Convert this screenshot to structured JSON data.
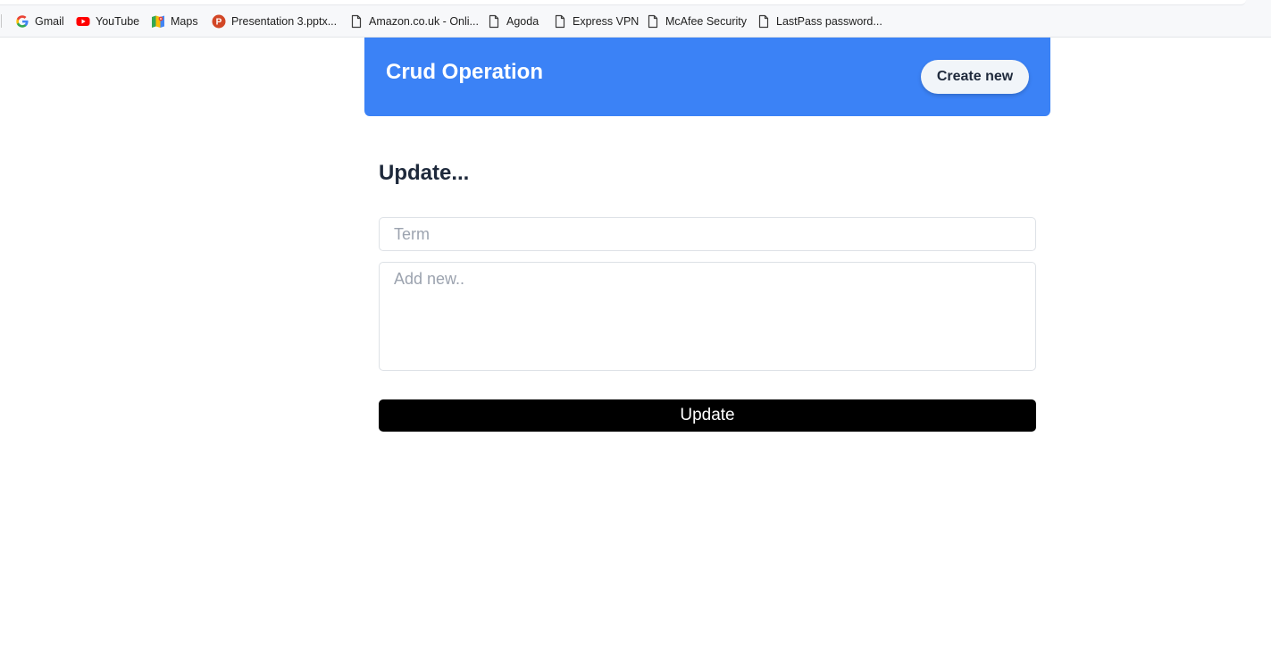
{
  "bookmarks": [
    {
      "label": "Gmail",
      "icon": "google-icon"
    },
    {
      "label": "YouTube",
      "icon": "youtube-icon"
    },
    {
      "label": "Maps",
      "icon": "maps-icon"
    },
    {
      "label": "Presentation 3.pptx...",
      "icon": "powerpoint-icon"
    },
    {
      "label": "Amazon.co.uk - Onli...",
      "icon": "page-icon"
    },
    {
      "label": "Agoda",
      "icon": "page-icon"
    },
    {
      "label": "Express VPN",
      "icon": "page-icon"
    },
    {
      "label": "McAfee Security",
      "icon": "page-icon"
    },
    {
      "label": "LastPass password...",
      "icon": "page-icon"
    }
  ],
  "header": {
    "title": "Crud Operation",
    "create_label": "Create new",
    "accent": "#3b82f6"
  },
  "form": {
    "title": "Update...",
    "term_placeholder": "Term",
    "term_value": "",
    "desc_placeholder": "Add new..",
    "desc_value": "",
    "submit_label": "Update"
  }
}
